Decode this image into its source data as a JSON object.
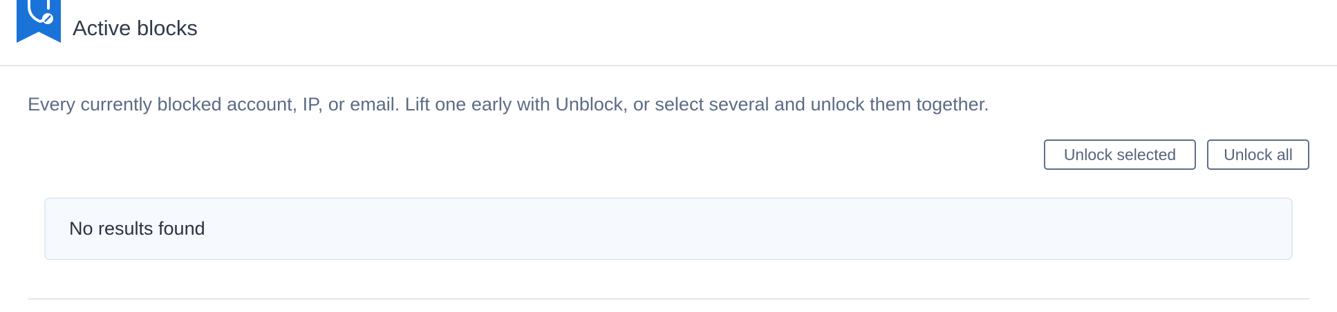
{
  "header": {
    "title": "Active blocks",
    "icon": "shield-block-icon",
    "accent_color": "#1a73d9"
  },
  "description": "Every currently blocked account, IP, or email. Lift one early with Unblock, or select several and unlock them together.",
  "toolbar": {
    "unlock_selected_label": "Unlock selected",
    "unlock_all_label": "Unlock all"
  },
  "results": {
    "empty_message": "No results found"
  }
}
